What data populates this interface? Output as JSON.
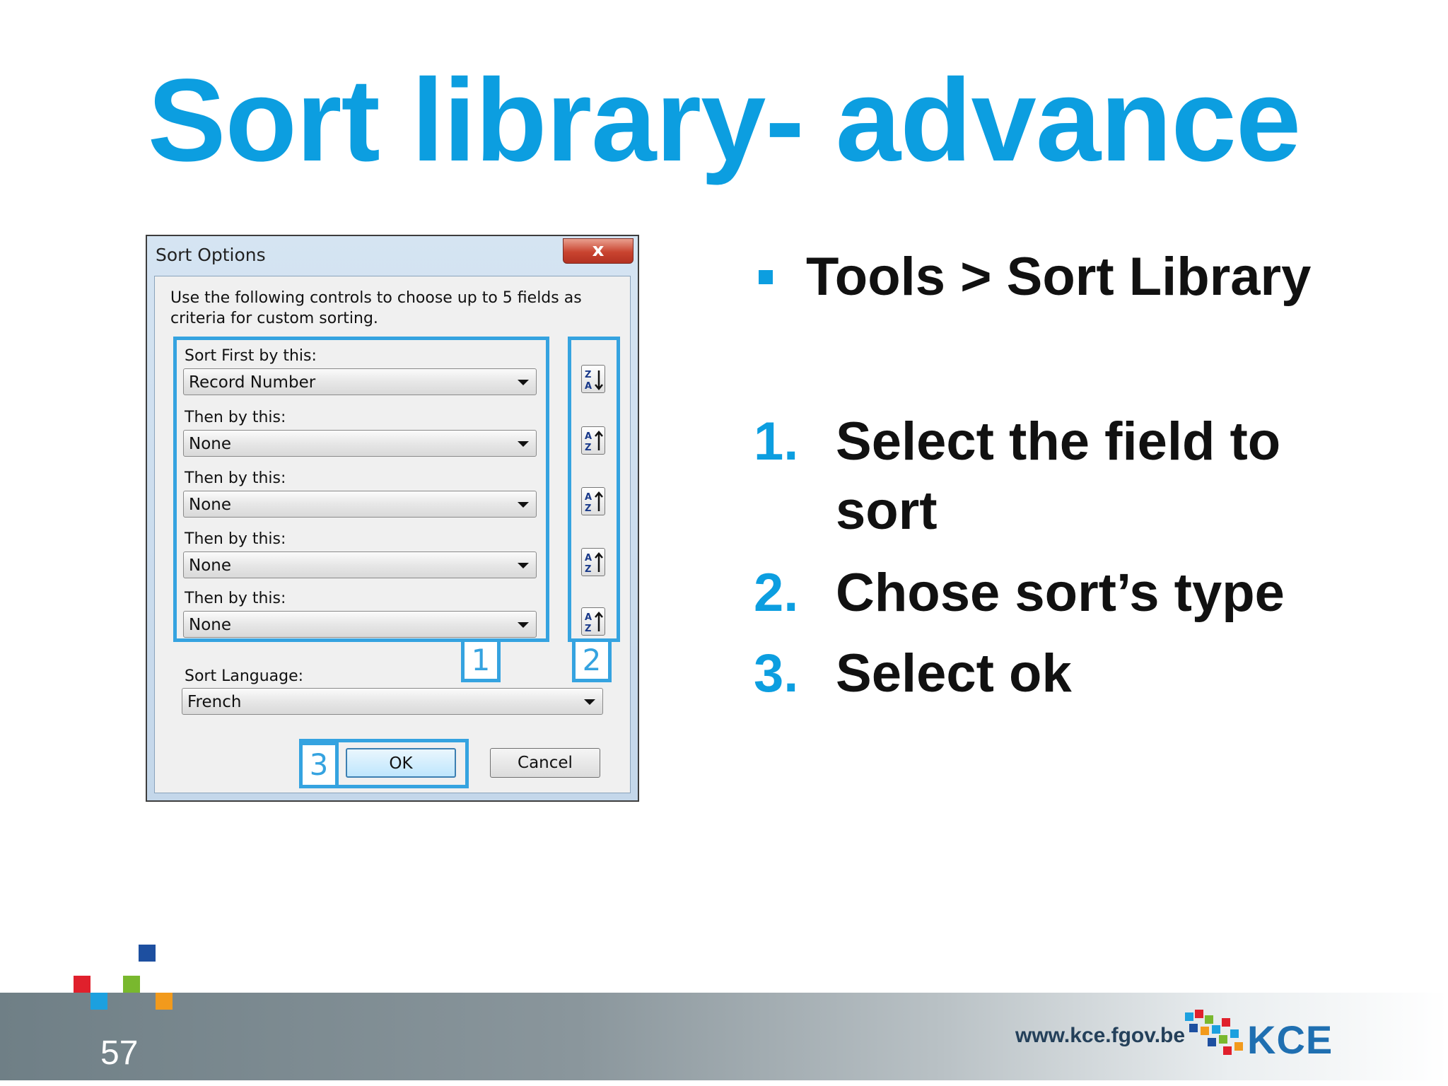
{
  "slide": {
    "title": "Sort library- advance",
    "page_number": "57",
    "footer_url": "www.kce.fgov.be",
    "footer_logo": "KCE",
    "accent_color": "#0c9ee0"
  },
  "dialog": {
    "title": "Sort Options",
    "close_glyph": "x",
    "instructions": "Use the following controls to choose up to 5 fields as criteria for custom sorting.",
    "fields": [
      {
        "label": "Sort First by this:",
        "value": "Record Number",
        "order_icon": "sort-descending-icon"
      },
      {
        "label": "Then by this:",
        "value": "None",
        "order_icon": "sort-ascending-icon"
      },
      {
        "label": "Then by this:",
        "value": "None",
        "order_icon": "sort-ascending-icon"
      },
      {
        "label": "Then by this:",
        "value": "None",
        "order_icon": "sort-ascending-icon"
      },
      {
        "label": "Then by this:",
        "value": "None",
        "order_icon": "sort-ascending-icon"
      }
    ],
    "language_label": "Sort Language:",
    "language_value": "French",
    "ok_label": "OK",
    "cancel_label": "Cancel",
    "callouts": [
      "1",
      "2",
      "3"
    ],
    "highlight_color": "#35a3e0"
  },
  "content": {
    "bullet": "Tools > Sort Library",
    "steps": [
      {
        "num": "1.",
        "text": "Select the field to sort"
      },
      {
        "num": "2.",
        "text": "Chose sort’s type"
      },
      {
        "num": "3.",
        "text": "Select ok"
      }
    ]
  }
}
